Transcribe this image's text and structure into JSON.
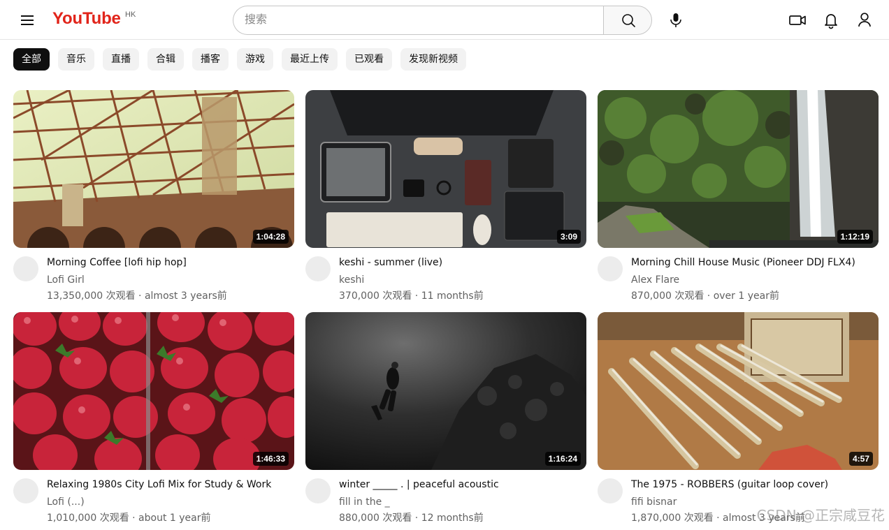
{
  "header": {
    "logo_text": "YouTube",
    "logo_region": "HK",
    "search_placeholder": "搜索",
    "icons": [
      "menu-icon",
      "search-icon",
      "mic-icon",
      "video-camera-icon",
      "bell-icon",
      "account-icon"
    ],
    "brand_color": "#e1241a"
  },
  "chips": [
    {
      "label": "全部",
      "active": true
    },
    {
      "label": "音乐",
      "active": false
    },
    {
      "label": "直播",
      "active": false
    },
    {
      "label": "合辑",
      "active": false
    },
    {
      "label": "播客",
      "active": false
    },
    {
      "label": "游戏",
      "active": false
    },
    {
      "label": "最近上传",
      "active": false
    },
    {
      "label": "已观看",
      "active": false
    },
    {
      "label": "发现新视频",
      "active": false
    }
  ],
  "videos": [
    {
      "title": "Morning Coffee [lofi hip hop]",
      "channel": "Lofi Girl",
      "meta": "13,350,000 次观看 · almost 3 years前",
      "duration": "1:04:28",
      "thumb": "bridge"
    },
    {
      "title": "keshi - summer (live)",
      "channel": "keshi",
      "meta": "370,000 次观看 · 11 months前",
      "duration": "3:09",
      "thumb": "desk"
    },
    {
      "title": "Morning Chill House Music (Pioneer DDJ FLX4)",
      "channel": "Alex Flare",
      "meta": "870,000 次观看 · over 1 year前",
      "duration": "1:12:19",
      "thumb": "waterfall"
    },
    {
      "title": "Relaxing 1980s City Lofi Mix for Study & Work",
      "channel": "Lofi (...)",
      "meta": "1,010,000 次观看 · about 1 year前",
      "duration": "1:46:33",
      "thumb": "strawberries"
    },
    {
      "title": "winter _____ . | peaceful acoustic",
      "channel": "fill in the _",
      "meta": "880,000 次观看 · 12 months前",
      "duration": "1:16:24",
      "thumb": "diver"
    },
    {
      "title": "The 1975 - ROBBERS (guitar loop cover)",
      "channel": "fifi bisnar",
      "meta": "1,870,000 次观看 · almost 3 years前",
      "duration": "4:57",
      "thumb": "rulers"
    }
  ],
  "watermark": "CSDN @正宗咸豆花"
}
